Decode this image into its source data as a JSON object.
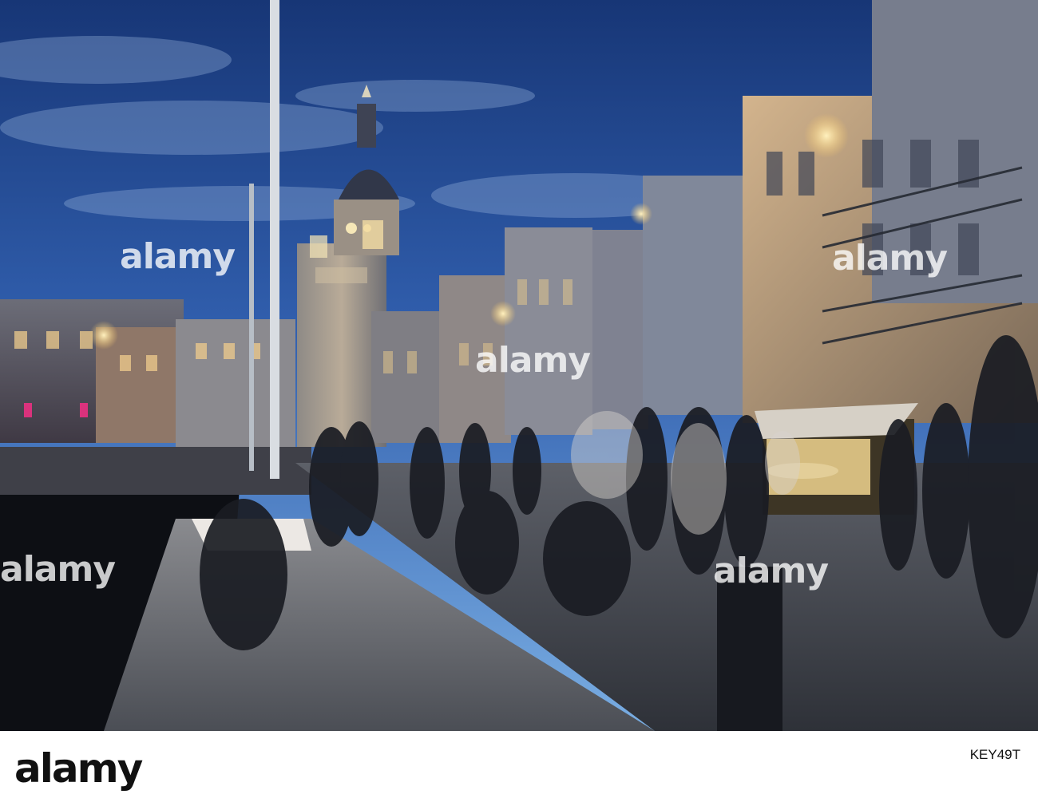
{
  "watermark": {
    "text": "alamy"
  },
  "footer": {
    "logo": "alamy",
    "image_id": "KEY49T"
  },
  "colors": {
    "sky_top": "#1d3f86",
    "sky_mid": "#3c6bb7",
    "sky_low": "#6fa6df",
    "building_warm": "#c8a77f",
    "building_cool": "#5f6d83",
    "pavement": "#4f5560",
    "water": "#111318"
  }
}
